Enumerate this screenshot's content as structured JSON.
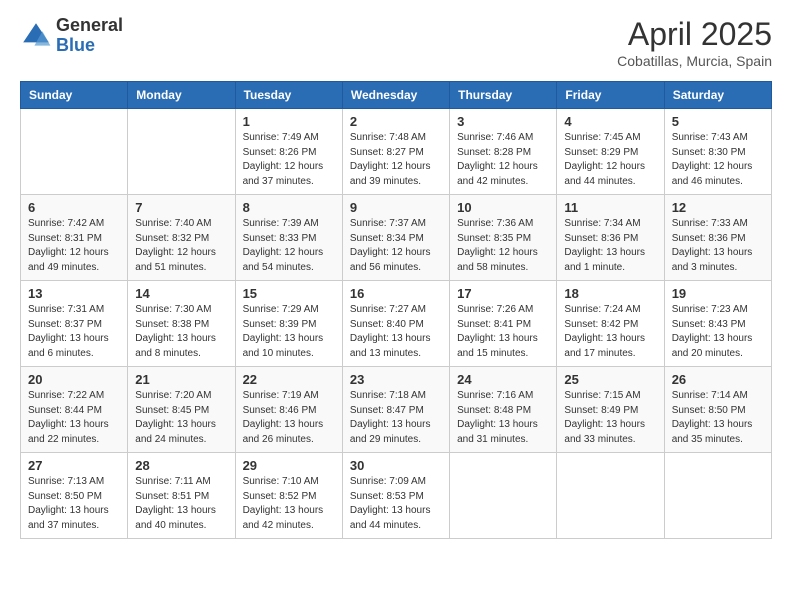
{
  "header": {
    "logo_general": "General",
    "logo_blue": "Blue",
    "title": "April 2025",
    "subtitle": "Cobatillas, Murcia, Spain"
  },
  "calendar": {
    "days_of_week": [
      "Sunday",
      "Monday",
      "Tuesday",
      "Wednesday",
      "Thursday",
      "Friday",
      "Saturday"
    ],
    "weeks": [
      [
        {
          "day": "",
          "info": ""
        },
        {
          "day": "",
          "info": ""
        },
        {
          "day": "1",
          "info": "Sunrise: 7:49 AM\nSunset: 8:26 PM\nDaylight: 12 hours and 37 minutes."
        },
        {
          "day": "2",
          "info": "Sunrise: 7:48 AM\nSunset: 8:27 PM\nDaylight: 12 hours and 39 minutes."
        },
        {
          "day": "3",
          "info": "Sunrise: 7:46 AM\nSunset: 8:28 PM\nDaylight: 12 hours and 42 minutes."
        },
        {
          "day": "4",
          "info": "Sunrise: 7:45 AM\nSunset: 8:29 PM\nDaylight: 12 hours and 44 minutes."
        },
        {
          "day": "5",
          "info": "Sunrise: 7:43 AM\nSunset: 8:30 PM\nDaylight: 12 hours and 46 minutes."
        }
      ],
      [
        {
          "day": "6",
          "info": "Sunrise: 7:42 AM\nSunset: 8:31 PM\nDaylight: 12 hours and 49 minutes."
        },
        {
          "day": "7",
          "info": "Sunrise: 7:40 AM\nSunset: 8:32 PM\nDaylight: 12 hours and 51 minutes."
        },
        {
          "day": "8",
          "info": "Sunrise: 7:39 AM\nSunset: 8:33 PM\nDaylight: 12 hours and 54 minutes."
        },
        {
          "day": "9",
          "info": "Sunrise: 7:37 AM\nSunset: 8:34 PM\nDaylight: 12 hours and 56 minutes."
        },
        {
          "day": "10",
          "info": "Sunrise: 7:36 AM\nSunset: 8:35 PM\nDaylight: 12 hours and 58 minutes."
        },
        {
          "day": "11",
          "info": "Sunrise: 7:34 AM\nSunset: 8:36 PM\nDaylight: 13 hours and 1 minute."
        },
        {
          "day": "12",
          "info": "Sunrise: 7:33 AM\nSunset: 8:36 PM\nDaylight: 13 hours and 3 minutes."
        }
      ],
      [
        {
          "day": "13",
          "info": "Sunrise: 7:31 AM\nSunset: 8:37 PM\nDaylight: 13 hours and 6 minutes."
        },
        {
          "day": "14",
          "info": "Sunrise: 7:30 AM\nSunset: 8:38 PM\nDaylight: 13 hours and 8 minutes."
        },
        {
          "day": "15",
          "info": "Sunrise: 7:29 AM\nSunset: 8:39 PM\nDaylight: 13 hours and 10 minutes."
        },
        {
          "day": "16",
          "info": "Sunrise: 7:27 AM\nSunset: 8:40 PM\nDaylight: 13 hours and 13 minutes."
        },
        {
          "day": "17",
          "info": "Sunrise: 7:26 AM\nSunset: 8:41 PM\nDaylight: 13 hours and 15 minutes."
        },
        {
          "day": "18",
          "info": "Sunrise: 7:24 AM\nSunset: 8:42 PM\nDaylight: 13 hours and 17 minutes."
        },
        {
          "day": "19",
          "info": "Sunrise: 7:23 AM\nSunset: 8:43 PM\nDaylight: 13 hours and 20 minutes."
        }
      ],
      [
        {
          "day": "20",
          "info": "Sunrise: 7:22 AM\nSunset: 8:44 PM\nDaylight: 13 hours and 22 minutes."
        },
        {
          "day": "21",
          "info": "Sunrise: 7:20 AM\nSunset: 8:45 PM\nDaylight: 13 hours and 24 minutes."
        },
        {
          "day": "22",
          "info": "Sunrise: 7:19 AM\nSunset: 8:46 PM\nDaylight: 13 hours and 26 minutes."
        },
        {
          "day": "23",
          "info": "Sunrise: 7:18 AM\nSunset: 8:47 PM\nDaylight: 13 hours and 29 minutes."
        },
        {
          "day": "24",
          "info": "Sunrise: 7:16 AM\nSunset: 8:48 PM\nDaylight: 13 hours and 31 minutes."
        },
        {
          "day": "25",
          "info": "Sunrise: 7:15 AM\nSunset: 8:49 PM\nDaylight: 13 hours and 33 minutes."
        },
        {
          "day": "26",
          "info": "Sunrise: 7:14 AM\nSunset: 8:50 PM\nDaylight: 13 hours and 35 minutes."
        }
      ],
      [
        {
          "day": "27",
          "info": "Sunrise: 7:13 AM\nSunset: 8:50 PM\nDaylight: 13 hours and 37 minutes."
        },
        {
          "day": "28",
          "info": "Sunrise: 7:11 AM\nSunset: 8:51 PM\nDaylight: 13 hours and 40 minutes."
        },
        {
          "day": "29",
          "info": "Sunrise: 7:10 AM\nSunset: 8:52 PM\nDaylight: 13 hours and 42 minutes."
        },
        {
          "day": "30",
          "info": "Sunrise: 7:09 AM\nSunset: 8:53 PM\nDaylight: 13 hours and 44 minutes."
        },
        {
          "day": "",
          "info": ""
        },
        {
          "day": "",
          "info": ""
        },
        {
          "day": "",
          "info": ""
        }
      ]
    ]
  }
}
